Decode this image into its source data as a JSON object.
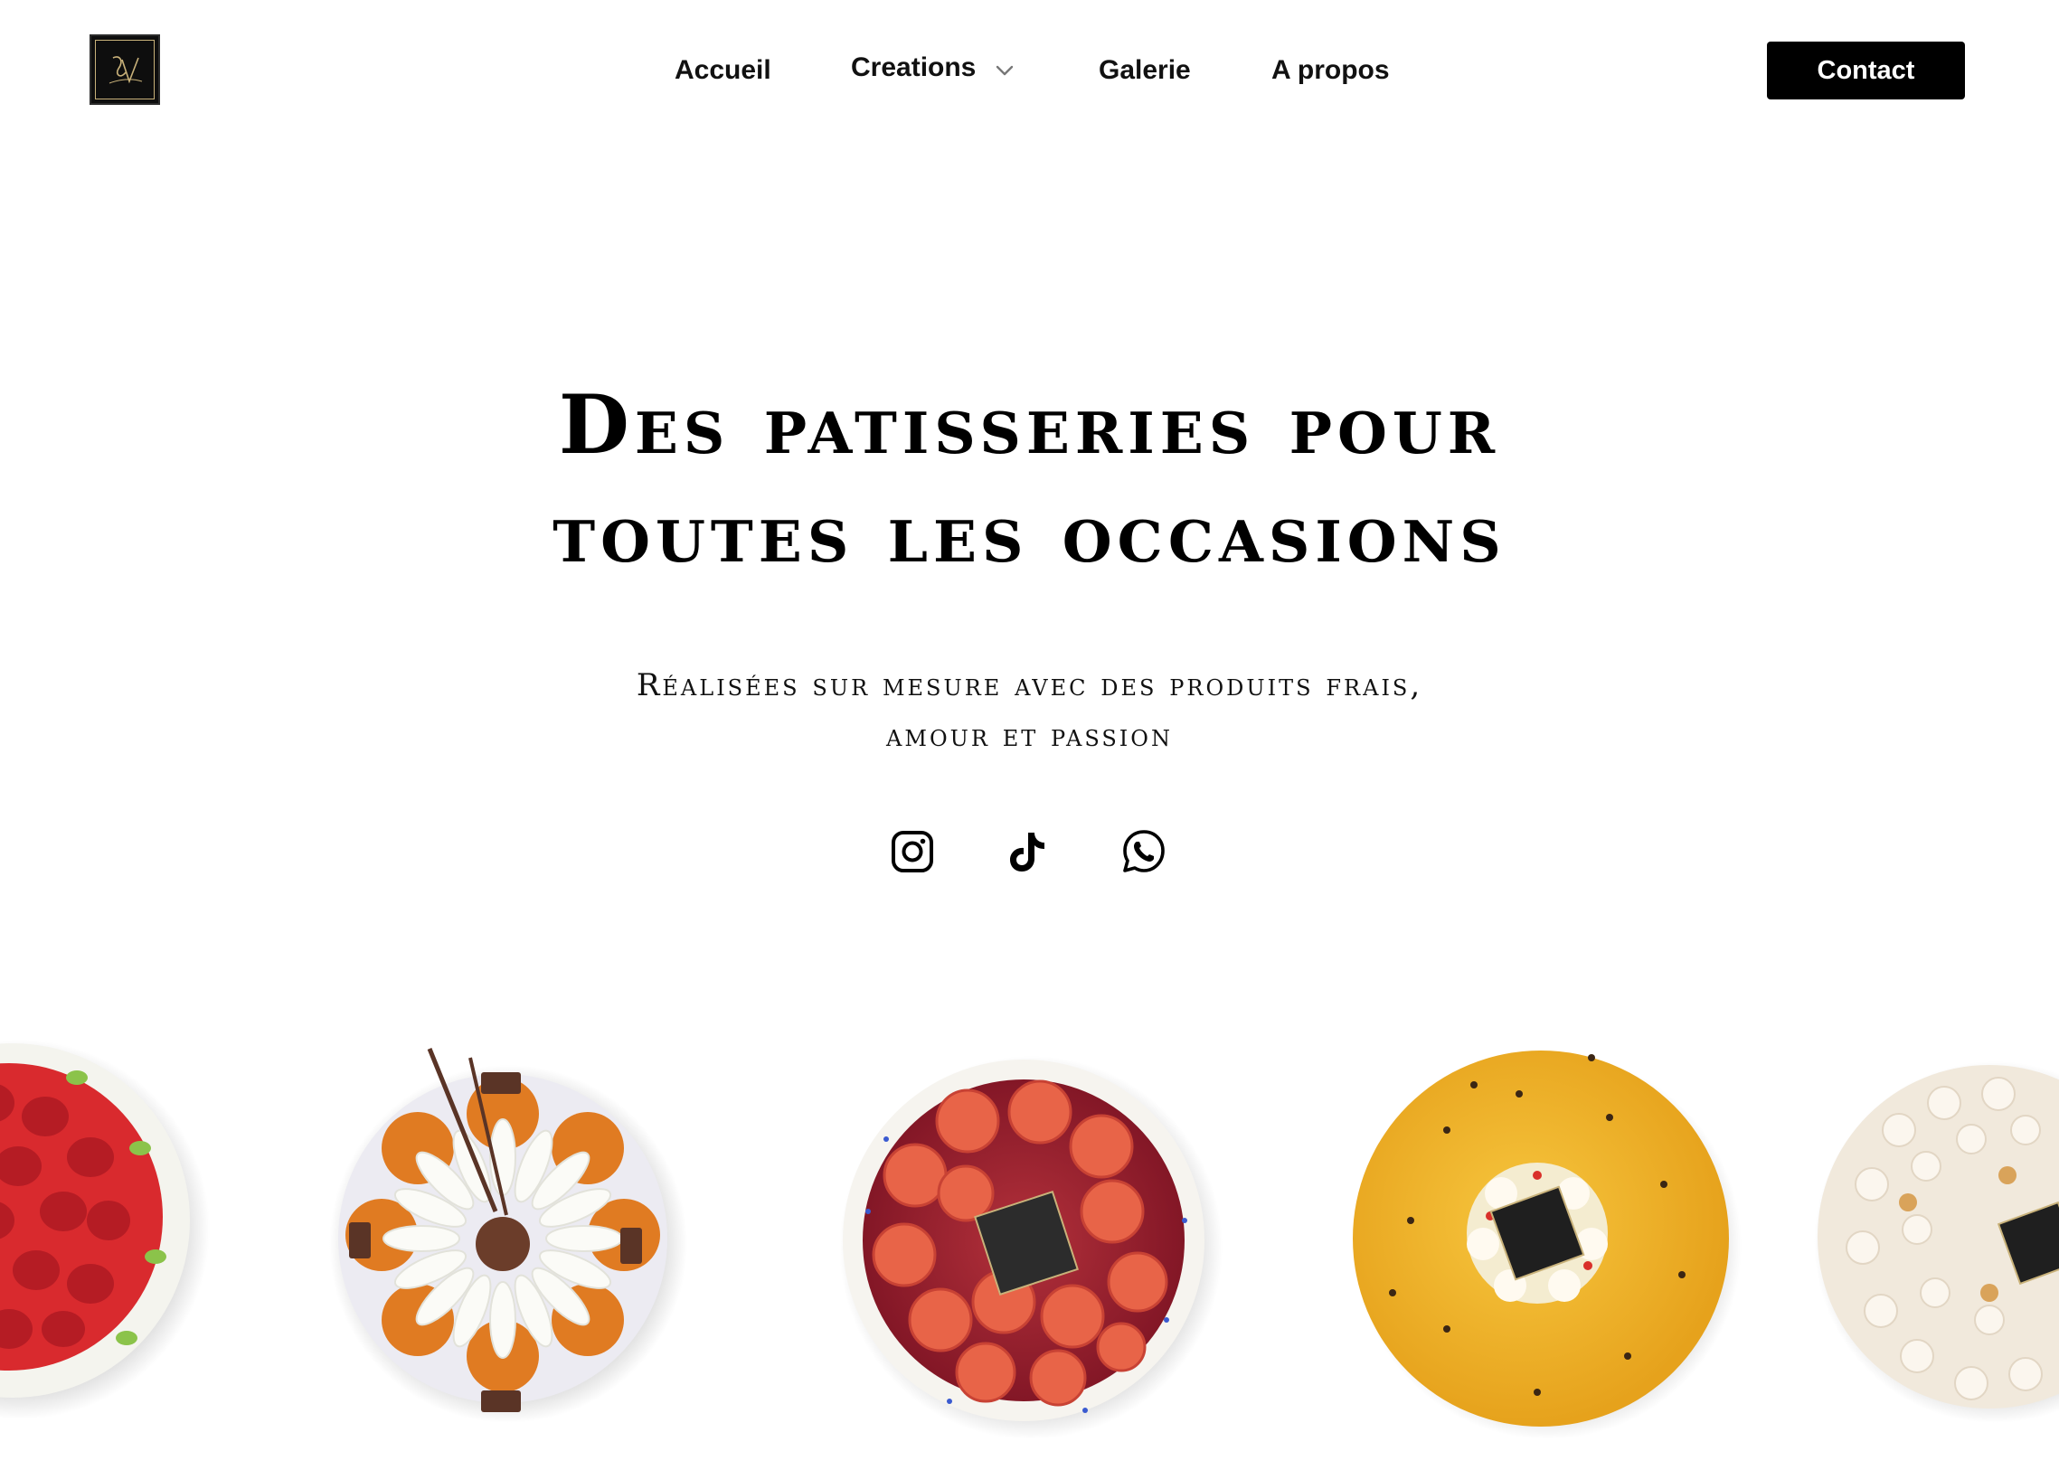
{
  "header": {
    "logo_text": "JV",
    "nav": [
      {
        "label": "Accueil",
        "has_dropdown": false
      },
      {
        "label": "Creations",
        "has_dropdown": true
      },
      {
        "label": "Galerie",
        "has_dropdown": false
      },
      {
        "label": "A propos",
        "has_dropdown": false
      }
    ],
    "contact_label": "Contact"
  },
  "hero": {
    "title_line1": "Des patisseries pour",
    "title_line2": "toutes les occasions",
    "subtitle_line1": "Réalisées sur mesure avec des produits frais,",
    "subtitle_line2": "amour et passion"
  },
  "socials": [
    "instagram-icon",
    "tiktok-icon",
    "whatsapp-icon"
  ],
  "carousel": {
    "items": [
      "strawberry-tart",
      "choux-clock-cake",
      "fig-tart",
      "passion-fruit-entremet",
      "meringue-tart"
    ]
  },
  "colors": {
    "background": "#ffffff",
    "text": "#000000",
    "button": "#000000",
    "button_text": "#ffffff",
    "logo_gold": "#c9b27a"
  }
}
